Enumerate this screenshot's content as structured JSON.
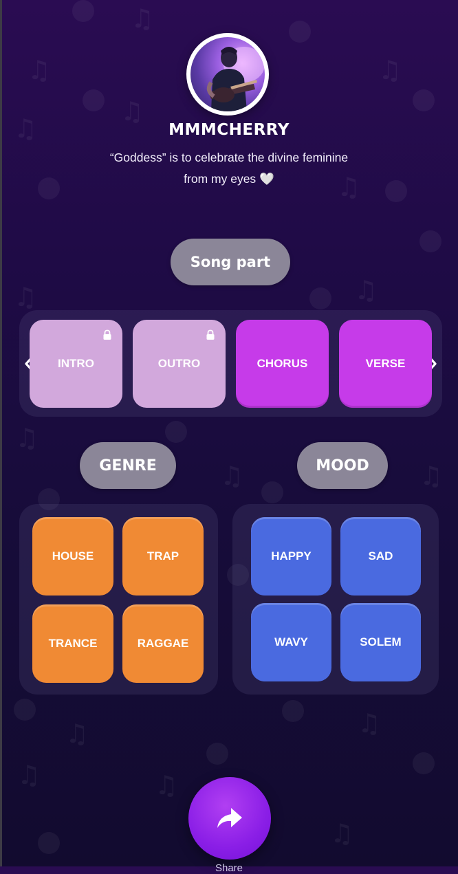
{
  "profile": {
    "artist_name": "MMMCHERRY",
    "bio": "“Goddess” is to celebrate the divine feminine from my eyes 🤍"
  },
  "song_part": {
    "label": "Song part",
    "items": [
      {
        "label": "INTRO",
        "locked": true
      },
      {
        "label": "OUTRO",
        "locked": true
      },
      {
        "label": "CHORUS",
        "locked": false
      },
      {
        "label": "VERSE",
        "locked": false
      }
    ]
  },
  "genre": {
    "label": "GENRE",
    "items": [
      "HOUSE",
      "TRAP",
      "TRANCE",
      "RAGGAE"
    ]
  },
  "mood": {
    "label": "MOOD",
    "items": [
      "HAPPY",
      "SAD",
      "WAVY",
      "SOLEM"
    ]
  },
  "share": {
    "label": "Share"
  },
  "icons": {
    "left": "chevron-left-icon",
    "right": "chevron-right-icon",
    "lock": "lock-icon",
    "share": "share-arrow-icon"
  },
  "colors": {
    "locked_tile": "#d2a8dc",
    "active_tile": "#c63be9",
    "genre_tile": "#f08a34",
    "mood_tile": "#4a6ae0",
    "pill": "#8b8698",
    "share_button": "#8a1ee6"
  }
}
